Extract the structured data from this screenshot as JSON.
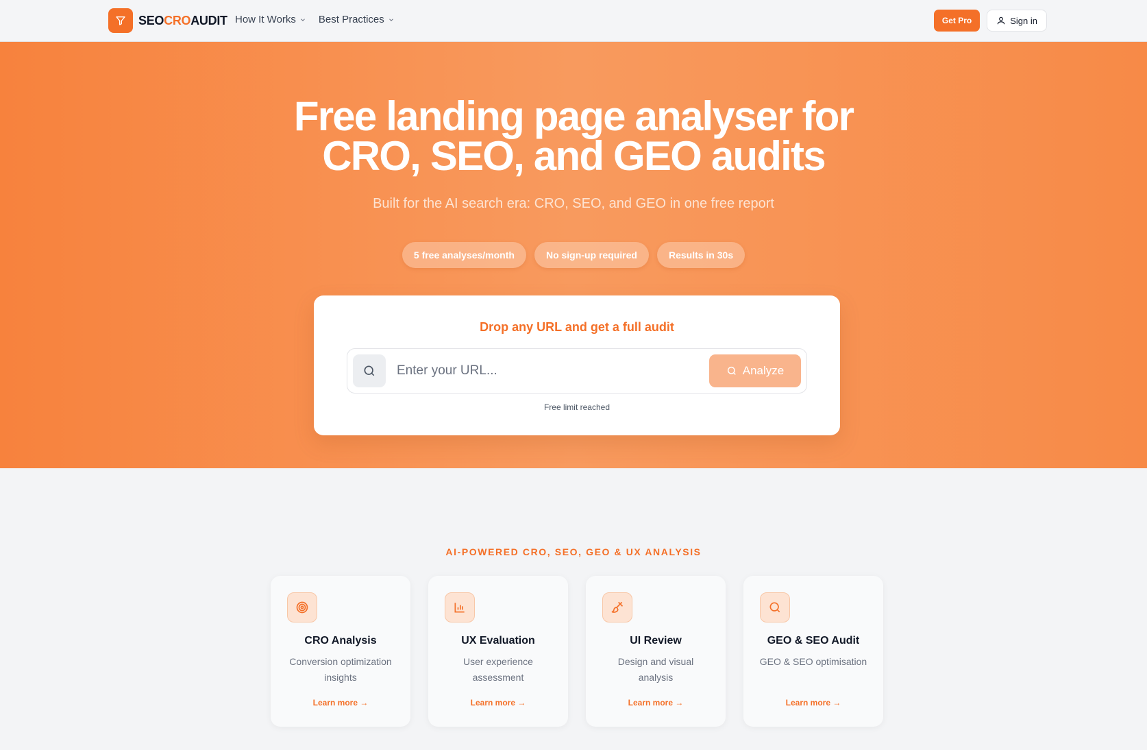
{
  "nav": {
    "logo": {
      "part1": "SEO",
      "part2": "CRO",
      "part3": "AUDIT"
    },
    "menu": [
      {
        "label": "How It Works"
      },
      {
        "label": "Best Practices"
      }
    ],
    "get_pro": "Get Pro",
    "sign_in": "Sign in"
  },
  "hero": {
    "title_line1": "Free landing page analyser for",
    "title_line2": "CRO, SEO, and GEO audits",
    "subtitle": "Built for the AI search era: CRO, SEO, and GEO in one free report",
    "pills": [
      "5 free analyses/month",
      "No sign-up required",
      "Results in 30s"
    ]
  },
  "audit_card": {
    "title": "Drop any URL and get a full audit",
    "input_placeholder": "Enter your URL...",
    "input_value": "",
    "analyze_label": "Analyze",
    "limit_text": "Free limit reached"
  },
  "features": {
    "label": "AI-POWERED CRO, SEO, GEO & UX ANALYSIS",
    "items": [
      {
        "icon": "target-icon",
        "title": "CRO Analysis",
        "desc": "Conversion optimization insights",
        "link": "Learn more →"
      },
      {
        "icon": "bar-chart-icon",
        "title": "UX Evaluation",
        "desc": "User experience assessment",
        "link": "Learn more →"
      },
      {
        "icon": "paintbrush-icon",
        "title": "UI Review",
        "desc": "Design and visual analysis",
        "link": "Learn more →"
      },
      {
        "icon": "search-icon",
        "title": "GEO & SEO Audit",
        "desc": "GEO & SEO optimisation",
        "link": "Learn more →"
      }
    ]
  },
  "colors": {
    "accent": "#f47028",
    "hero_gradient_start": "#f7823d",
    "hero_gradient_end": "#f89a5e",
    "analyze_disabled": "#f9b48c"
  }
}
